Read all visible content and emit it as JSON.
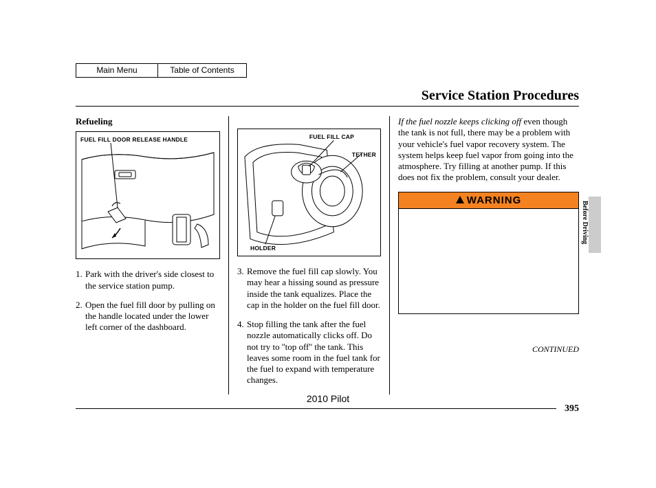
{
  "nav": {
    "main_menu": "Main Menu",
    "toc": "Table of Contents"
  },
  "title": "Service Station Procedures",
  "section_head": "Refueling",
  "fig1": {
    "label_release": "FUEL FILL DOOR RELEASE HANDLE"
  },
  "fig2": {
    "label_cap": "FUEL FILL CAP",
    "label_tether": "TETHER",
    "label_holder": "HOLDER"
  },
  "steps_col1": [
    {
      "n": "1.",
      "t": "Park with the driver's side closest to the service station pump."
    },
    {
      "n": "2.",
      "t": "Open the fuel fill door by pulling on the handle located under the lower left corner of the dashboard."
    }
  ],
  "steps_col2": [
    {
      "n": "3.",
      "t": "Remove the fuel fill cap slowly. You may hear a hissing sound as pressure inside the tank equalizes. Place the cap in the holder on the fuel fill door."
    },
    {
      "n": "4.",
      "t": "Stop filling the tank after the fuel nozzle automatically clicks off. Do not try to ''top off'' the tank. This leaves some room in the fuel tank for the fuel to expand with temperature changes."
    }
  ],
  "col3": {
    "lead_italic": "If the fuel nozzle keeps clicking off",
    "lead_rest": " even though the tank is not full, there may be a problem with your vehicle's fuel vapor recovery system. The system helps keep fuel vapor from going into the atmosphere. Try filling at another pump. If this does not fix the problem, consult your dealer."
  },
  "warning": {
    "head": "WARNING",
    "bullets": [
      "",
      "",
      ""
    ]
  },
  "continued": "CONTINUED",
  "page_number": "395",
  "footer_model": "2010 Pilot",
  "side_label": "Before Driving"
}
